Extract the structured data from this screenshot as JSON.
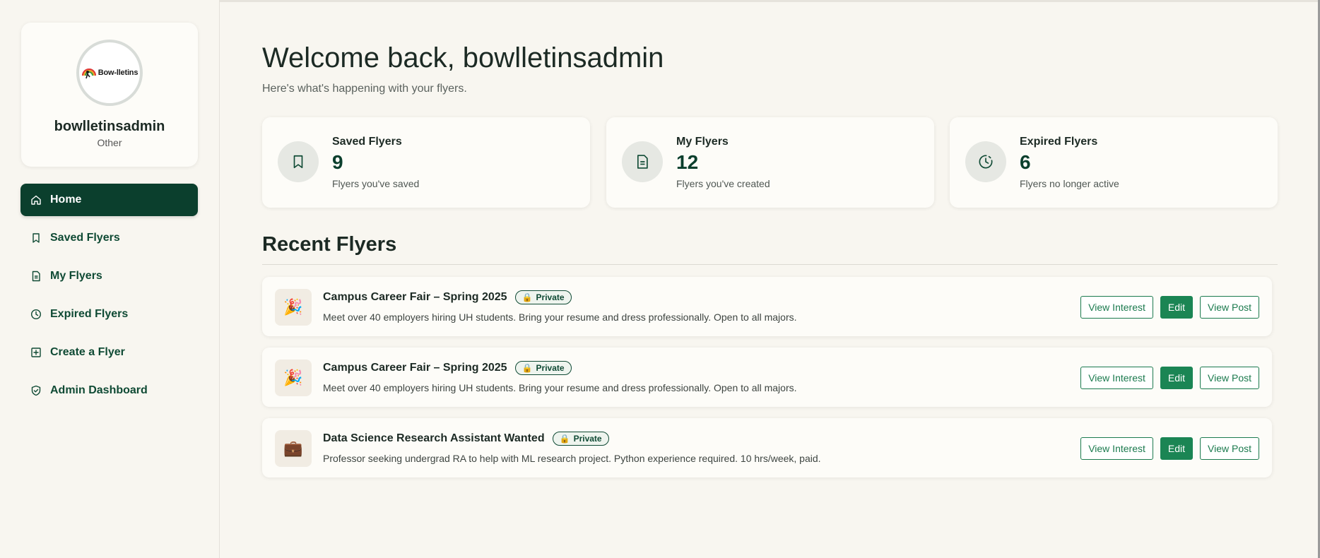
{
  "colors": {
    "primary_dark": "#0b3f2d",
    "accent_green": "#1b8554",
    "background": "#f8f6f0",
    "card": "#fdfcf8"
  },
  "profile": {
    "logo_text": "Bow-lletins",
    "name": "bowlletinsadmin",
    "role": "Other"
  },
  "sidebar": {
    "items": [
      {
        "label": "Home",
        "icon": "home-icon",
        "active": true
      },
      {
        "label": "Saved Flyers",
        "icon": "bookmark-icon"
      },
      {
        "label": "My Flyers",
        "icon": "document-icon"
      },
      {
        "label": "Expired Flyers",
        "icon": "clock-icon"
      },
      {
        "label": "Create a Flyer",
        "icon": "plus-square-icon"
      },
      {
        "label": "Admin Dashboard",
        "icon": "shield-check-icon"
      }
    ]
  },
  "header": {
    "welcome": "Welcome back, bowlletinsadmin",
    "subtitle": "Here's what's happening with your flyers."
  },
  "stats": [
    {
      "label": "Saved Flyers",
      "value": "9",
      "desc": "Flyers you've saved",
      "icon": "bookmark-icon"
    },
    {
      "label": "My Flyers",
      "value": "12",
      "desc": "Flyers you've created",
      "icon": "document-icon"
    },
    {
      "label": "Expired Flyers",
      "value": "6",
      "desc": "Flyers no longer active",
      "icon": "clock-icon"
    }
  ],
  "recent": {
    "title": "Recent Flyers",
    "flyers": [
      {
        "icon": "party-popper-icon",
        "title": "Campus Career Fair – Spring 2025",
        "badge": "Private",
        "desc": "Meet over 40 employers hiring UH students. Bring your resume and dress professionally. Open to all majors."
      },
      {
        "icon": "party-popper-icon",
        "title": "Campus Career Fair – Spring 2025",
        "badge": "Private",
        "desc": "Meet over 40 employers hiring UH students. Bring your resume and dress professionally. Open to all majors."
      },
      {
        "icon": "briefcase-icon",
        "title": "Data Science Research Assistant Wanted",
        "badge": "Private",
        "desc": "Professor seeking undergrad RA to help with ML research project. Python experience required. 10 hrs/week, paid."
      }
    ],
    "actions": {
      "view_interest": "View Interest",
      "edit": "Edit",
      "view_post": "View Post"
    }
  }
}
